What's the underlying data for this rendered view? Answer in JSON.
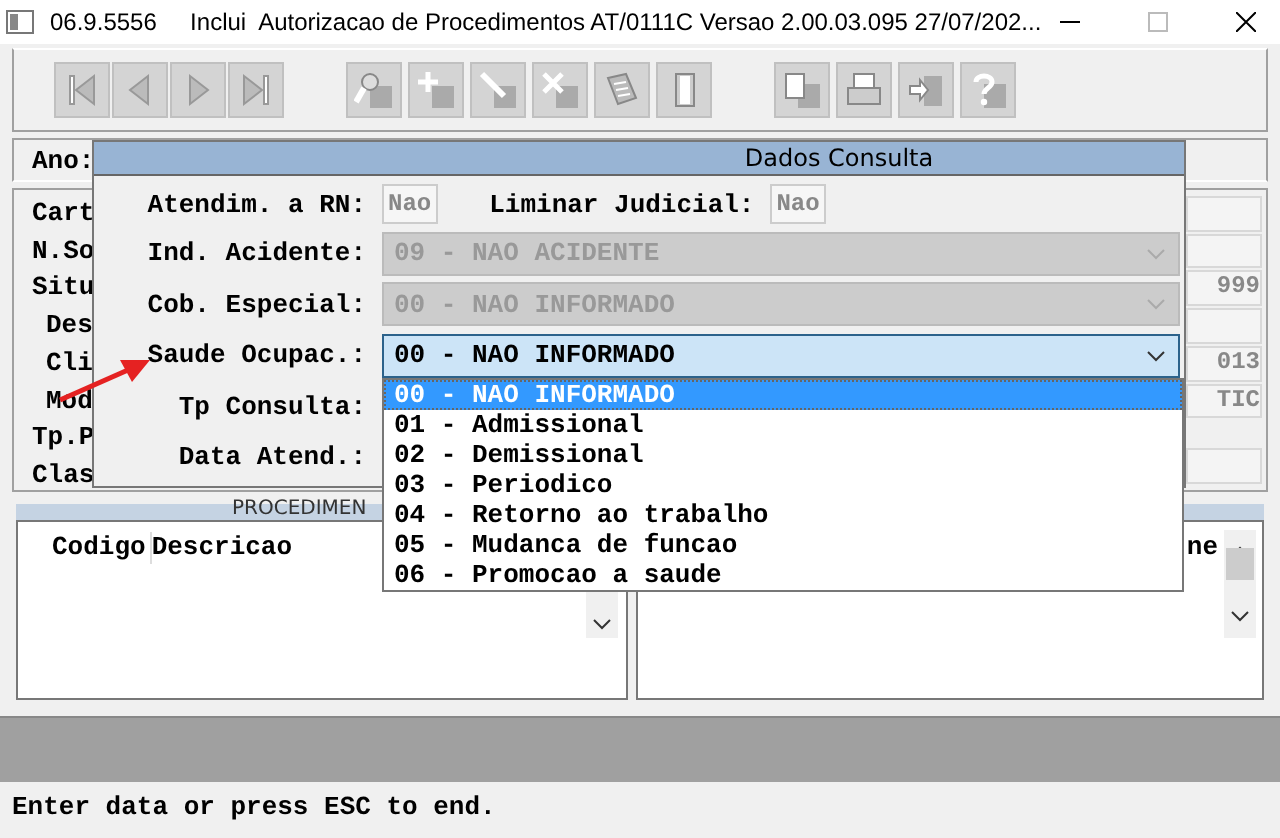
{
  "window": {
    "title": "06.9.5556     Inclui  Autorizacao de Procedimentos AT/0111C Versao 2.00.03.095 27/07/202..."
  },
  "toolbar": {
    "buttons": [
      {
        "kind": "first",
        "disabled": true
      },
      {
        "kind": "previous",
        "disabled": true
      },
      {
        "kind": "next",
        "disabled": true
      },
      {
        "kind": "last",
        "disabled": true
      },
      {
        "kind": "search",
        "disabled": true
      },
      {
        "kind": "add",
        "disabled": true
      },
      {
        "kind": "edit",
        "disabled": true
      },
      {
        "kind": "delete",
        "disabled": true
      },
      {
        "kind": "notes",
        "disabled": true
      },
      {
        "kind": "exit",
        "disabled": true
      },
      {
        "kind": "document",
        "disabled": true
      },
      {
        "kind": "print",
        "disabled": true
      },
      {
        "kind": "import",
        "disabled": true
      },
      {
        "kind": "help",
        "disabled": true
      }
    ]
  },
  "form": {
    "year_label": "Ano:",
    "labels": [
      {
        "text": "Cart",
        "indent": false
      },
      {
        "text": "N.So",
        "indent": false
      },
      {
        "text": "Situ",
        "indent": false
      },
      {
        "text": "Des",
        "indent": true
      },
      {
        "text": "Cli",
        "indent": true
      },
      {
        "text": "Mod",
        "indent": true
      },
      {
        "text": "Tp.P",
        "indent": false
      },
      {
        "text": "Clas",
        "indent": false
      }
    ],
    "right_fields": [
      "999",
      "013",
      "TIC"
    ]
  },
  "dialog": {
    "title": "Dados Consulta",
    "rn_label": "Atendim. a RN:",
    "rn_value": "Nao",
    "liminar_label": "Liminar Judicial:",
    "liminar_value": "Nao",
    "combos": [
      {
        "label": "Ind. Acidente:",
        "value": "09 - NAO ACIDENTE",
        "disabled": true,
        "expanded": false
      },
      {
        "label": "Cob. Especial:",
        "value": "00 - NAO INFORMADO",
        "disabled": true,
        "expanded": false
      },
      {
        "label": "Saude Ocupac.:",
        "value": "00 - NAO INFORMADO",
        "disabled": false,
        "expanded": true
      }
    ],
    "other_labels": [
      "Tp Consulta:",
      "Data Atend.:"
    ],
    "options": [
      {
        "text": "00 - NAO INFORMADO",
        "selected": true
      },
      {
        "text": "01 - Admissional",
        "selected": false
      },
      {
        "text": "02 - Demissional",
        "selected": false
      },
      {
        "text": "03 - Periodico",
        "selected": false
      },
      {
        "text": "04 - Retorno ao trabalho",
        "selected": false
      },
      {
        "text": "05 - Mudanca de funcao",
        "selected": false
      },
      {
        "text": "06 - Promocao a saude",
        "selected": false
      }
    ]
  },
  "procedures": {
    "title": "PROCEDIMEN",
    "columns": [
      "Codigo",
      "Descricao"
    ],
    "right_column": "ne"
  },
  "status_bar": "Enter data or press ESC to end."
}
